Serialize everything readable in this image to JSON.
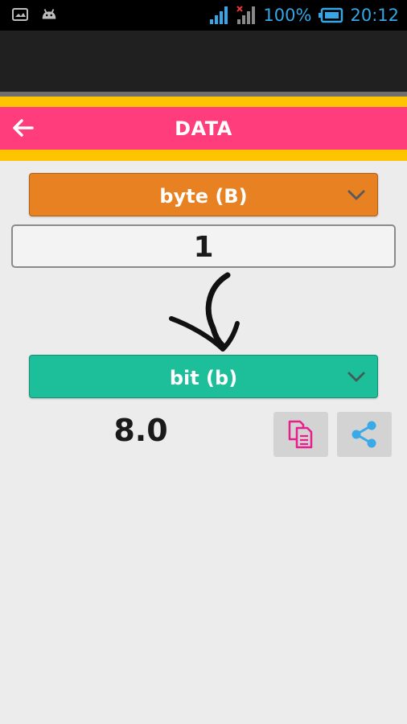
{
  "status_bar": {
    "battery_text": "100%",
    "time": "20:12",
    "accent_color": "#35a6e6",
    "icons": [
      "screenshot-icon",
      "android-icon",
      "signal-icon",
      "signal-no-data-icon",
      "battery-icon"
    ]
  },
  "app_bar": {
    "title": "DATA",
    "back_icon": "arrow-left-icon",
    "color": "#ff3d7c",
    "stripe_color": "#ffc400"
  },
  "converter": {
    "from_unit": "byte (B)",
    "from_color": "#e88122",
    "input_value": "1",
    "to_unit": "bit (b)",
    "to_color": "#1dbf9b",
    "result": "8.0",
    "copy_icon": "copy-icon",
    "share_icon": "share-icon"
  }
}
